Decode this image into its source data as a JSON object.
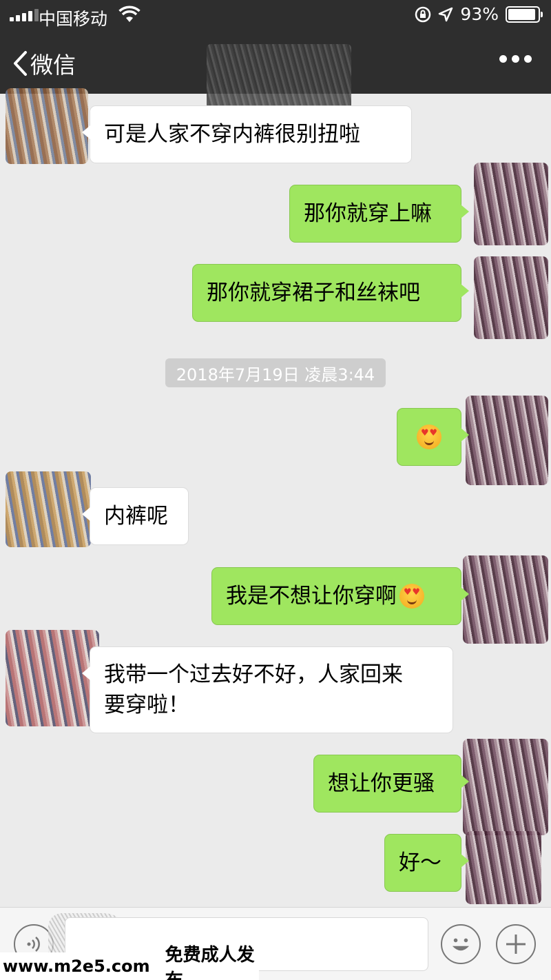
{
  "status_bar": {
    "carrier": "中国移动",
    "battery": "93%",
    "battery_level": 0.93
  },
  "nav": {
    "back_label": "微信"
  },
  "messages": [
    {
      "side": "in",
      "text": "可是人家不穿内裤很别扭啦"
    },
    {
      "side": "out",
      "text": "那你就穿上嘛"
    },
    {
      "side": "out",
      "text": "那你就穿裙子和丝袜吧"
    },
    {
      "side": "out",
      "text": "",
      "emoji": "heart-eyes-emoji"
    },
    {
      "side": "in",
      "text": "内裤呢"
    },
    {
      "side": "out",
      "text": "我是不想让你穿啊",
      "emoji": "heart-eyes-emoji"
    },
    {
      "side": "in",
      "text_line1": "我带一个过去好不好，人家回来",
      "text_line2": "要穿啦！"
    },
    {
      "side": "out",
      "text": "想让你更骚"
    },
    {
      "side": "out",
      "text": "好～"
    }
  ],
  "timestamp": "2018年7月19日 凌晨3:44",
  "watermark": {
    "url": "www.m2e5.com",
    "slogan": "免费成人发布"
  },
  "colors": {
    "outgoing_bubble": "#9fe65f",
    "incoming_bubble": "#ffffff",
    "chat_background": "#ebebeb",
    "top_bar": "#2e2e2e"
  }
}
